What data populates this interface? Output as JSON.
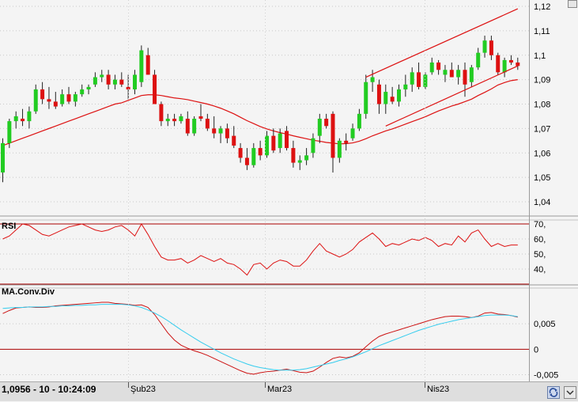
{
  "status": {
    "readout": "1,0956 - 10 - 10:24:09",
    "date_labels": [
      "Şub23",
      "Mar23",
      "Nis23"
    ]
  },
  "colors": {
    "up_candle": "#22cc22",
    "down_candle": "#dd1111",
    "moving_average": "#dd1111",
    "rsi_line": "#dd1111",
    "macd_line": "#cc1111",
    "signal_line": "#33ccee",
    "reference_line": "#aa0000",
    "channel_line": "#dd1111"
  },
  "chart_data": [
    {
      "type": "candlestick",
      "title": "",
      "ylim": [
        1.04,
        1.12
      ],
      "y_ticks": [
        "1,04",
        "1,05",
        "1,06",
        "1,07",
        "1,08",
        "1,09",
        "1,1",
        "1,11",
        "1,12"
      ],
      "y_tick_values": [
        1.04,
        1.05,
        1.06,
        1.07,
        1.08,
        1.09,
        1.1,
        1.11,
        1.12
      ],
      "candles": [
        [
          1.052,
          1.066,
          1.048,
          1.064
        ],
        [
          1.064,
          1.074,
          1.062,
          1.073
        ],
        [
          1.073,
          1.077,
          1.07,
          1.075
        ],
        [
          1.074,
          1.078,
          1.071,
          1.073
        ],
        [
          1.073,
          1.079,
          1.07,
          1.077
        ],
        [
          1.077,
          1.088,
          1.076,
          1.086
        ],
        [
          1.086,
          1.089,
          1.08,
          1.082
        ],
        [
          1.082,
          1.087,
          1.078,
          1.081
        ],
        [
          1.081,
          1.085,
          1.078,
          1.079
        ],
        [
          1.08,
          1.086,
          1.079,
          1.084
        ],
        [
          1.084,
          1.087,
          1.08,
          1.081
        ],
        [
          1.081,
          1.085,
          1.079,
          1.084
        ],
        [
          1.084,
          1.088,
          1.083,
          1.086
        ],
        [
          1.086,
          1.088,
          1.084,
          1.087
        ],
        [
          1.088,
          1.093,
          1.087,
          1.091
        ],
        [
          1.091,
          1.094,
          1.089,
          1.092
        ],
        [
          1.092,
          1.094,
          1.086,
          1.088
        ],
        [
          1.088,
          1.092,
          1.086,
          1.09
        ],
        [
          1.09,
          1.093,
          1.087,
          1.088
        ],
        [
          1.087,
          1.092,
          1.082,
          1.086
        ],
        [
          1.086,
          1.094,
          1.084,
          1.092
        ],
        [
          1.089,
          1.104,
          1.087,
          1.102
        ],
        [
          1.1,
          1.103,
          1.092,
          1.092
        ],
        [
          1.092,
          1.094,
          1.08,
          1.08
        ],
        [
          1.08,
          1.081,
          1.071,
          1.073
        ],
        [
          1.073,
          1.076,
          1.071,
          1.074
        ],
        [
          1.074,
          1.076,
          1.071,
          1.073
        ],
        [
          1.073,
          1.076,
          1.072,
          1.075
        ],
        [
          1.074,
          1.077,
          1.067,
          1.068
        ],
        [
          1.068,
          1.075,
          1.067,
          1.074
        ],
        [
          1.075,
          1.08,
          1.073,
          1.074
        ],
        [
          1.074,
          1.076,
          1.069,
          1.07
        ],
        [
          1.07,
          1.075,
          1.066,
          1.068
        ],
        [
          1.068,
          1.071,
          1.064,
          1.07
        ],
        [
          1.07,
          1.072,
          1.064,
          1.066
        ],
        [
          1.067,
          1.071,
          1.062,
          1.063
        ],
        [
          1.062,
          1.064,
          1.056,
          1.058
        ],
        [
          1.058,
          1.062,
          1.053,
          1.055
        ],
        [
          1.055,
          1.064,
          1.054,
          1.062
        ],
        [
          1.062,
          1.065,
          1.057,
          1.059
        ],
        [
          1.059,
          1.069,
          1.058,
          1.067
        ],
        [
          1.067,
          1.07,
          1.06,
          1.061
        ],
        [
          1.062,
          1.07,
          1.06,
          1.068
        ],
        [
          1.069,
          1.071,
          1.061,
          1.062
        ],
        [
          1.062,
          1.065,
          1.054,
          1.056
        ],
        [
          1.056,
          1.059,
          1.053,
          1.057
        ],
        [
          1.057,
          1.062,
          1.055,
          1.059
        ],
        [
          1.06,
          1.068,
          1.058,
          1.066
        ],
        [
          1.067,
          1.076,
          1.064,
          1.074
        ],
        [
          1.074,
          1.076,
          1.07,
          1.071
        ],
        [
          1.076,
          1.077,
          1.052,
          1.058
        ],
        [
          1.058,
          1.066,
          1.056,
          1.065
        ],
        [
          1.065,
          1.068,
          1.061,
          1.064
        ],
        [
          1.066,
          1.072,
          1.065,
          1.07
        ],
        [
          1.07,
          1.078,
          1.069,
          1.076
        ],
        [
          1.076,
          1.092,
          1.074,
          1.089
        ],
        [
          1.089,
          1.094,
          1.085,
          1.091
        ],
        [
          1.088,
          1.09,
          1.076,
          1.08
        ],
        [
          1.08,
          1.088,
          1.076,
          1.085
        ],
        [
          1.083,
          1.087,
          1.08,
          1.081
        ],
        [
          1.081,
          1.088,
          1.079,
          1.086
        ],
        [
          1.086,
          1.092,
          1.083,
          1.088
        ],
        [
          1.088,
          1.095,
          1.085,
          1.093
        ],
        [
          1.093,
          1.097,
          1.086,
          1.087
        ],
        [
          1.087,
          1.093,
          1.086,
          1.092
        ],
        [
          1.093,
          1.099,
          1.092,
          1.097
        ],
        [
          1.097,
          1.098,
          1.092,
          1.094
        ],
        [
          1.092,
          1.096,
          1.089,
          1.094
        ],
        [
          1.094,
          1.097,
          1.091,
          1.091
        ],
        [
          1.091,
          1.096,
          1.088,
          1.094
        ],
        [
          1.094,
          1.097,
          1.083,
          1.088
        ],
        [
          1.089,
          1.096,
          1.087,
          1.095
        ],
        [
          1.095,
          1.103,
          1.094,
          1.101
        ],
        [
          1.101,
          1.108,
          1.099,
          1.106
        ],
        [
          1.106,
          1.108,
          1.098,
          1.1
        ],
        [
          1.1,
          1.101,
          1.092,
          1.093
        ],
        [
          1.093,
          1.099,
          1.091,
          1.098
        ],
        [
          1.098,
          1.1,
          1.096,
          1.097
        ],
        [
          1.097,
          1.099,
          1.094,
          1.0956
        ]
      ],
      "moving_average": [
        1.063,
        1.064,
        1.065,
        1.066,
        1.067,
        1.068,
        1.069,
        1.07,
        1.071,
        1.072,
        1.073,
        1.074,
        1.075,
        1.076,
        1.077,
        1.078,
        1.079,
        1.08,
        1.0805,
        1.0815,
        1.0825,
        1.0835,
        1.0838,
        1.0838,
        1.0835,
        1.083,
        1.0825,
        1.0822,
        1.0818,
        1.0812,
        1.0806,
        1.08,
        1.0792,
        1.0783,
        1.0772,
        1.076,
        1.0746,
        1.0732,
        1.072,
        1.0708,
        1.0698,
        1.069,
        1.0683,
        1.0677,
        1.067,
        1.0664,
        1.0658,
        1.0652,
        1.0648,
        1.0643,
        1.064,
        1.0637,
        1.0638,
        1.0641,
        1.0648,
        1.0658,
        1.067,
        1.068,
        1.069,
        1.0698,
        1.0708,
        1.0718,
        1.0728,
        1.0738,
        1.0748,
        1.076,
        1.0772,
        1.0782,
        1.0792,
        1.08,
        1.081,
        1.082,
        1.0835,
        1.0848,
        1.0862,
        1.0878,
        1.0888,
        1.0896,
        1.09
      ],
      "trend_channel": {
        "upper": [
          [
            55,
            1.091
          ],
          [
            78,
            1.119
          ]
        ],
        "lower": [
          [
            58,
            1.071
          ],
          [
            78,
            1.0956
          ]
        ]
      }
    },
    {
      "type": "line",
      "title": "RSI",
      "ylim": [
        30,
        70
      ],
      "y_ticks": [
        "70,",
        "60,",
        "50,",
        "40,"
      ],
      "y_tick_values": [
        70,
        60,
        50,
        40
      ],
      "reference_levels": [
        70,
        30
      ],
      "values": [
        60,
        62,
        66,
        70,
        69,
        66,
        63,
        62,
        64,
        66,
        68,
        69,
        70,
        68,
        66,
        65,
        66,
        68,
        69,
        66,
        62,
        70,
        63,
        55,
        48,
        46,
        46,
        47,
        44,
        46,
        49,
        47,
        45,
        47,
        44,
        43,
        40,
        36,
        43,
        44,
        40,
        44,
        46,
        45,
        42,
        42,
        46,
        52,
        57,
        52,
        50,
        48,
        50,
        53,
        58,
        61,
        64,
        60,
        55,
        57,
        56,
        58,
        60,
        59,
        61,
        59,
        55,
        57,
        56,
        62,
        58,
        64,
        66,
        60,
        55,
        57,
        55,
        56,
        56
      ]
    },
    {
      "type": "line",
      "title": "MA.Conv.Div",
      "ylim": [
        -0.006,
        0.012
      ],
      "y_ticks": [
        "0,005",
        "0",
        "-0,005"
      ],
      "y_tick_values": [
        0.005,
        0,
        -0.005
      ],
      "series": [
        {
          "values": [
            0.007,
            0.0076,
            0.0081,
            0.0082,
            0.0083,
            0.0082,
            0.0082,
            0.0083,
            0.0085,
            0.0086,
            0.0087,
            0.0088,
            0.0089,
            0.009,
            0.0091,
            0.0092,
            0.0092,
            0.009,
            0.0089,
            0.0088,
            0.0086,
            0.0087,
            0.0082,
            0.0068,
            0.005,
            0.0032,
            0.0018,
            0.0008,
            0.0002,
            -0.0003,
            -0.0007,
            -0.0012,
            -0.0018,
            -0.0024,
            -0.003,
            -0.0036,
            -0.0042,
            -0.0047,
            -0.0049,
            -0.0046,
            -0.0044,
            -0.0043,
            -0.0041,
            -0.0039,
            -0.0042,
            -0.0045,
            -0.0046,
            -0.0043,
            -0.0035,
            -0.0026,
            -0.0018,
            -0.0015,
            -0.0017,
            -0.0014,
            -0.0007,
            0.0005,
            0.0016,
            0.0025,
            0.003,
            0.0034,
            0.0038,
            0.0042,
            0.0046,
            0.005,
            0.0054,
            0.0058,
            0.0061,
            0.0064,
            0.0065,
            0.0065,
            0.0064,
            0.0062,
            0.0065,
            0.0071,
            0.0072,
            0.0069,
            0.0068,
            0.0066,
            0.0063
          ]
        },
        {
          "values": [
            0.008,
            0.0081,
            0.0082,
            0.0082,
            0.0083,
            0.0083,
            0.0083,
            0.0084,
            0.0084,
            0.0085,
            0.0085,
            0.0086,
            0.0086,
            0.0087,
            0.0087,
            0.0088,
            0.0088,
            0.0088,
            0.0088,
            0.0087,
            0.0085,
            0.0082,
            0.0077,
            0.0071,
            0.0064,
            0.0056,
            0.0047,
            0.0038,
            0.003,
            0.0022,
            0.0014,
            0.0007,
            0.0,
            -0.0007,
            -0.0013,
            -0.0019,
            -0.0024,
            -0.0029,
            -0.0033,
            -0.0036,
            -0.0038,
            -0.004,
            -0.0041,
            -0.0041,
            -0.0041,
            -0.004,
            -0.0038,
            -0.0035,
            -0.0032,
            -0.0029,
            -0.0026,
            -0.0022,
            -0.0019,
            -0.0015,
            -0.001,
            -0.0005,
            0.0001,
            0.0007,
            0.0012,
            0.0017,
            0.0022,
            0.0027,
            0.0032,
            0.0037,
            0.0041,
            0.0045,
            0.0049,
            0.0052,
            0.0055,
            0.0058,
            0.006,
            0.0062,
            0.0064,
            0.0066,
            0.0067,
            0.0067,
            0.0067,
            0.0066,
            0.0064
          ]
        }
      ],
      "reference_levels": [
        0
      ]
    }
  ]
}
